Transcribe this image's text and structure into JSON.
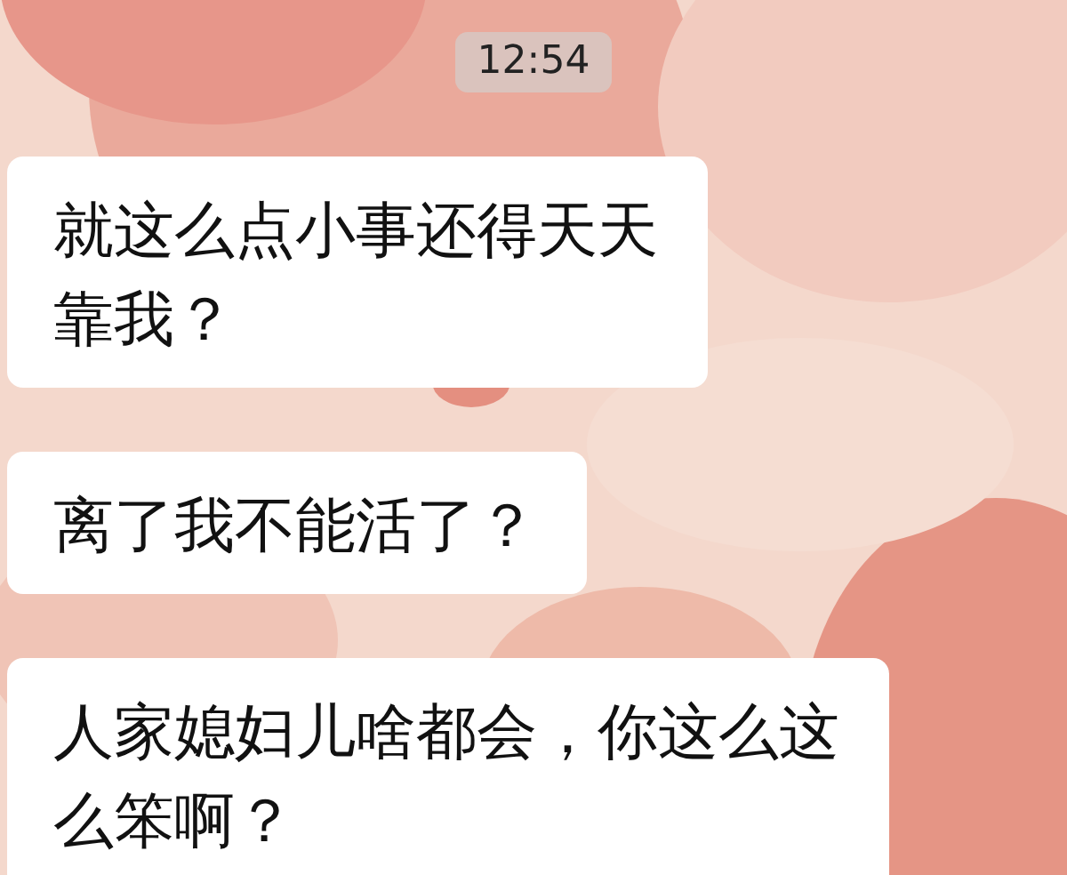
{
  "time": "12:54",
  "messages": [
    {
      "lines": [
        "就这么点小事还得天天",
        "靠我？"
      ]
    },
    {
      "lines": [
        "离了我不能活了？"
      ]
    },
    {
      "lines": [
        "人家媳妇儿啥都会，你这么这",
        "么笨啊？"
      ]
    }
  ]
}
